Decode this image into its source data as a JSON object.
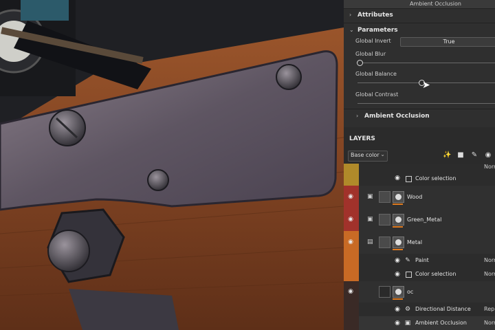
{
  "properties": {
    "header_title": "Ambient Occlusion",
    "attributes_label": "Attributes",
    "parameters_label": "Parameters",
    "global_invert_label": "Global Invert",
    "global_invert_value": "True",
    "global_blur_label": "Global Blur",
    "global_blur_value": 0.0,
    "global_balance_label": "Global Balance",
    "global_balance_value": 0.5,
    "global_contrast_label": "Global Contrast",
    "ambient_occlusion_section": "Ambient Occlusion"
  },
  "layers": {
    "title": "LAYERS",
    "channel_select": "Base color",
    "rows": [
      {
        "name": "Color selection",
        "kind": "sub",
        "icon": "checkbox-icon",
        "band": "#b08a2a"
      },
      {
        "name": "Wood",
        "kind": "folder",
        "band": "#a1322b"
      },
      {
        "name": "Green_Metal",
        "kind": "folder",
        "band": "#a1322b"
      },
      {
        "name": "Metal",
        "kind": "folder-open",
        "band": "#c86a25"
      },
      {
        "name": "Paint",
        "kind": "sub",
        "icon": "brush-icon",
        "blend": "Norm",
        "band": "#c86a25"
      },
      {
        "name": "Color selection",
        "kind": "sub",
        "icon": "checkbox-icon",
        "blend": "Norm",
        "band": "#c86a25"
      },
      {
        "name": "oc",
        "kind": "layer",
        "band": "#3a2a26"
      },
      {
        "name": "Directional Distance",
        "kind": "sub",
        "icon": "gear-icon",
        "blend": "Repl",
        "band": "#3a2a26"
      },
      {
        "name": "Ambient Occlusion",
        "kind": "sub",
        "icon": "square-icon",
        "blend": "Norm",
        "band": "#3a2a26"
      }
    ],
    "top_partial_blend": "Norm"
  },
  "colors": {
    "accent_orange": "#e07b1f",
    "wood": "#8a4a24",
    "metal": "#6d6270"
  }
}
